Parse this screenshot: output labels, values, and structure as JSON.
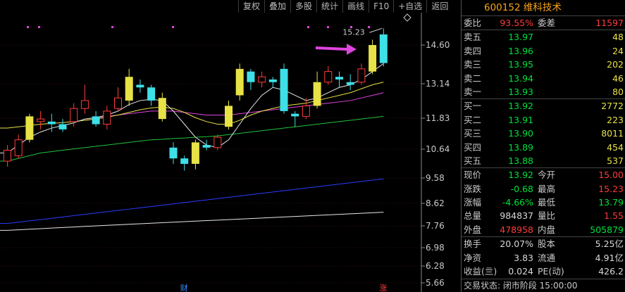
{
  "toolbar": {
    "buttons": [
      "复权",
      "叠加",
      "多股",
      "统计",
      "画线",
      "F10",
      "+自选",
      "返回"
    ]
  },
  "colors": {
    "up": "#e7e246",
    "down": "#3ee0e8",
    "red": "#ff3b3b",
    "green": "#00e23a",
    "ma5": "#e6e6e6",
    "ma10": "#e7e246",
    "ma20": "#e044e0",
    "ma60": "#23c23a",
    "ma120": "#2b3bff",
    "ma250": "#e6e6e6",
    "arrow": "#e044e0"
  },
  "chart_data": {
    "type": "candlestick",
    "y_ticks": [
      "14.60",
      "13.14",
      "11.83",
      "10.64",
      "9.58",
      "8.62",
      "7.76",
      "6.98",
      "6.28",
      "5.66"
    ],
    "high_label": "15.23",
    "markers": [
      {
        "label": "财",
        "index": 16,
        "color": "#3b8cff"
      },
      {
        "label": "涨",
        "index": 34,
        "color": "#ff3b3b"
      }
    ],
    "candles": [
      {
        "o": 10.2,
        "c": 10.6,
        "h": 10.8,
        "l": 10.0
      },
      {
        "o": 10.4,
        "c": 11.0,
        "h": 11.2,
        "l": 10.3
      },
      {
        "o": 11.0,
        "c": 11.9,
        "h": 12.0,
        "l": 10.9
      },
      {
        "o": 11.7,
        "c": 11.8,
        "h": 12.1,
        "l": 11.4
      },
      {
        "o": 11.7,
        "c": 11.6,
        "h": 12.0,
        "l": 11.3
      },
      {
        "o": 11.6,
        "c": 11.4,
        "h": 11.8,
        "l": 11.3
      },
      {
        "o": 11.7,
        "c": 12.2,
        "h": 12.4,
        "l": 11.5
      },
      {
        "o": 12.2,
        "c": 12.5,
        "h": 13.1,
        "l": 12.0
      },
      {
        "o": 11.9,
        "c": 11.6,
        "h": 12.1,
        "l": 11.5
      },
      {
        "o": 11.6,
        "c": 12.1,
        "h": 12.3,
        "l": 11.4
      },
      {
        "o": 12.2,
        "c": 12.6,
        "h": 13.0,
        "l": 12.1
      },
      {
        "o": 12.5,
        "c": 13.4,
        "h": 13.7,
        "l": 12.3
      },
      {
        "o": 13.1,
        "c": 13.0,
        "h": 13.3,
        "l": 12.8
      },
      {
        "o": 13.0,
        "c": 12.5,
        "h": 13.1,
        "l": 12.3
      },
      {
        "o": 11.8,
        "c": 12.6,
        "h": 12.8,
        "l": 11.7
      },
      {
        "o": 10.7,
        "c": 10.3,
        "h": 10.9,
        "l": 10.1
      },
      {
        "o": 10.3,
        "c": 10.1,
        "h": 10.4,
        "l": 9.85
      },
      {
        "o": 10.1,
        "c": 10.9,
        "h": 11.0,
        "l": 9.9
      },
      {
        "o": 10.8,
        "c": 10.7,
        "h": 11.0,
        "l": 10.6
      },
      {
        "o": 10.7,
        "c": 11.1,
        "h": 11.2,
        "l": 10.6
      },
      {
        "o": 11.5,
        "c": 12.3,
        "h": 12.5,
        "l": 11.4
      },
      {
        "o": 12.7,
        "c": 13.7,
        "h": 13.9,
        "l": 12.5
      },
      {
        "o": 13.6,
        "c": 13.2,
        "h": 13.7,
        "l": 12.9
      },
      {
        "o": 13.2,
        "c": 13.4,
        "h": 13.6,
        "l": 13.0
      },
      {
        "o": 13.3,
        "c": 13.2,
        "h": 13.4,
        "l": 13.0
      },
      {
        "o": 13.7,
        "c": 12.1,
        "h": 13.9,
        "l": 12.0
      },
      {
        "o": 12.0,
        "c": 11.9,
        "h": 12.1,
        "l": 11.5
      },
      {
        "o": 11.9,
        "c": 12.3,
        "h": 12.6,
        "l": 11.8
      },
      {
        "o": 12.3,
        "c": 13.2,
        "h": 13.6,
        "l": 12.2
      },
      {
        "o": 13.2,
        "c": 13.6,
        "h": 13.8,
        "l": 13.1
      },
      {
        "o": 13.4,
        "c": 13.3,
        "h": 13.6,
        "l": 13.0
      },
      {
        "o": 13.2,
        "c": 13.1,
        "h": 13.5,
        "l": 12.9
      },
      {
        "o": 13.2,
        "c": 13.7,
        "h": 13.9,
        "l": 13.1
      },
      {
        "o": 13.6,
        "c": 14.6,
        "h": 14.8,
        "l": 13.5
      },
      {
        "o": 15.0,
        "c": 13.92,
        "h": 15.23,
        "l": 13.79
      }
    ],
    "ma5": [
      10.5,
      10.8,
      11.1,
      11.3,
      11.45,
      11.55,
      11.65,
      11.8,
      11.85,
      11.95,
      12.1,
      12.35,
      12.5,
      12.55,
      12.5,
      12.1,
      11.6,
      11.1,
      10.8,
      10.7,
      11.0,
      11.6,
      12.2,
      12.7,
      13.0,
      12.9,
      12.7,
      12.5,
      12.6,
      12.8,
      13.0,
      13.1,
      13.3,
      13.6,
      13.9
    ],
    "ma10": [
      11.45,
      11.5,
      11.55,
      11.6,
      11.63,
      11.66,
      11.7,
      11.75,
      11.8,
      11.87,
      11.95,
      12.05,
      12.15,
      12.22,
      12.25,
      12.2,
      12.05,
      11.85,
      11.7,
      11.6,
      11.6,
      11.75,
      11.95,
      12.1,
      12.2,
      12.3,
      12.35,
      12.4,
      12.5,
      12.6,
      12.7,
      12.8,
      12.95,
      13.1,
      13.2
    ],
    "ma20": [
      null,
      null,
      null,
      null,
      null,
      null,
      null,
      11.8,
      11.85,
      11.9,
      11.95,
      12.0,
      12.05,
      12.1,
      12.1,
      12.1,
      12.05,
      12.0,
      11.95,
      11.95,
      11.95,
      12.0,
      12.05,
      12.1,
      12.15,
      12.2,
      12.25,
      12.3,
      12.35,
      12.4,
      12.45,
      12.5,
      12.6,
      12.7,
      12.8
    ],
    "ma60": [
      10.2,
      10.3,
      10.4,
      10.5,
      10.55,
      10.6,
      10.65,
      10.7,
      10.75,
      10.8,
      10.85,
      10.9,
      10.95,
      11.0,
      11.02,
      11.05,
      11.07,
      11.1,
      11.12,
      11.15,
      11.2,
      11.25,
      11.3,
      11.35,
      11.4,
      11.45,
      11.5,
      11.55,
      11.6,
      11.65,
      11.7,
      11.75,
      11.8,
      11.85,
      11.9
    ],
    "ma120": [
      7.85,
      7.9,
      7.95,
      8.0,
      8.05,
      8.1,
      8.15,
      8.2,
      8.25,
      8.3,
      8.35,
      8.4,
      8.45,
      8.5,
      8.55,
      8.6,
      8.65,
      8.7,
      8.75,
      8.8,
      8.85,
      8.9,
      8.95,
      9.0,
      9.05,
      9.1,
      9.15,
      9.2,
      9.25,
      9.3,
      9.35,
      9.4,
      9.45,
      9.5,
      9.55
    ],
    "ma250": [
      7.6,
      7.62,
      7.64,
      7.66,
      7.68,
      7.7,
      7.72,
      7.74,
      7.76,
      7.78,
      7.8,
      7.82,
      7.84,
      7.86,
      7.88,
      7.9,
      7.92,
      7.94,
      7.96,
      7.98,
      8.0,
      8.02,
      8.04,
      8.06,
      8.08,
      8.1,
      8.12,
      8.14,
      8.16,
      8.18,
      8.2,
      8.22,
      8.24,
      8.26,
      8.28
    ]
  },
  "quote": {
    "code_name": "600152 维科技术",
    "weibi_label": "委比",
    "weibi": "93.55%",
    "weicha_label": "委差",
    "weicha": "11597",
    "sell": [
      {
        "label": "卖五",
        "price": "13.97",
        "vol": "48"
      },
      {
        "label": "卖四",
        "price": "13.96",
        "vol": "24"
      },
      {
        "label": "卖三",
        "price": "13.95",
        "vol": "202"
      },
      {
        "label": "卖二",
        "price": "13.94",
        "vol": "46"
      },
      {
        "label": "卖一",
        "price": "13.93",
        "vol": "80"
      }
    ],
    "buy": [
      {
        "label": "买一",
        "price": "13.92",
        "vol": "2772"
      },
      {
        "label": "买二",
        "price": "13.91",
        "vol": "223"
      },
      {
        "label": "买三",
        "price": "13.90",
        "vol": "8011"
      },
      {
        "label": "买四",
        "price": "13.89",
        "vol": "454"
      },
      {
        "label": "买五",
        "price": "13.88",
        "vol": "537"
      }
    ],
    "stats": [
      {
        "l1": "现价",
        "v1": "13.92",
        "c1": "green",
        "l2": "今开",
        "v2": "15.00",
        "c2": "red"
      },
      {
        "l1": "涨跌",
        "v1": "-0.68",
        "c1": "green",
        "l2": "最高",
        "v2": "15.23",
        "c2": "red"
      },
      {
        "l1": "涨幅",
        "v1": "-4.66%",
        "c1": "green",
        "l2": "最低",
        "v2": "13.79",
        "c2": "green"
      },
      {
        "l1": "总量",
        "v1": "984837",
        "c1": "white",
        "l2": "量比",
        "v2": "1.55",
        "c2": "red"
      },
      {
        "l1": "外盘",
        "v1": "478958",
        "c1": "red",
        "l2": "内盘",
        "v2": "505879",
        "c2": "green"
      }
    ],
    "fund": [
      {
        "l1": "换手",
        "v1": "20.07%",
        "l2": "股本",
        "v2": "5.25亿"
      },
      {
        "l1": "净资",
        "v1": "3.83",
        "l2": "流通",
        "v2": "4.91亿"
      },
      {
        "l1": "收益(亖)",
        "v1": "0.024",
        "l2": "PE(动)",
        "v2": "426.2"
      }
    ],
    "status": "交易状态: 闭市阶段 15:00:00"
  }
}
